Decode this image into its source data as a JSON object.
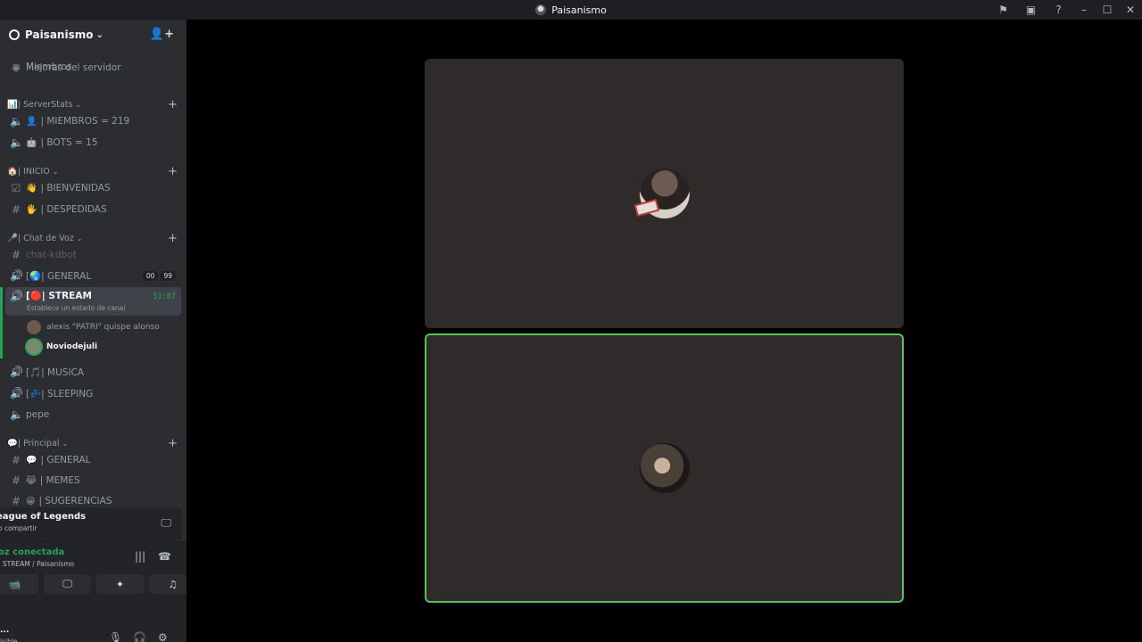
{
  "window": {
    "title": "Paisanismo"
  },
  "server": {
    "name": "Paisanismo"
  },
  "sidebar": {
    "top_items": [
      {
        "label": "Miembros",
        "icon": "members-icon"
      },
      {
        "label": "Mejoras del servidor",
        "icon": "boost-icon"
      }
    ],
    "categories": [
      {
        "label": "| ServerStats",
        "emoji": "📊",
        "channels": [
          {
            "label": "| MIEMBROS = 219",
            "emoji": "👤",
            "icon": "locked-voice-icon"
          },
          {
            "label": "| BOTS = 15",
            "emoji": "🤖",
            "icon": "locked-voice-icon"
          }
        ]
      },
      {
        "label": "| INICIO",
        "emoji": "🏠",
        "channels": [
          {
            "label": "| BIENVENIDAS",
            "emoji": "👋",
            "icon": "rules-icon"
          },
          {
            "label": "| DESPEDIDAS",
            "emoji": "🖐",
            "icon": "hash-icon"
          }
        ]
      },
      {
        "label": "| Chat de Voz",
        "emoji": "🎤",
        "channels": [
          {
            "label": "chat-kdbot",
            "icon": "hash-icon"
          },
          {
            "label": "[🌏| GENERAL",
            "icon": "voice-icon",
            "badges": [
              "00",
              "99"
            ]
          },
          {
            "label": "[🔴| STREAM",
            "icon": "voice-active-icon",
            "sub": "Establece un estado de canal",
            "timer": "51:07"
          },
          {
            "label": "[🎵| MUSICA",
            "icon": "voice-icon"
          },
          {
            "label": "[💤| SLEEPING",
            "icon": "voice-icon"
          },
          {
            "label": "pepe",
            "icon": "locked-voice-icon"
          }
        ]
      },
      {
        "label": "| Principal",
        "emoji": "💬",
        "channels": [
          {
            "label": "| GENERAL",
            "emoji": "💬",
            "icon": "hash-icon"
          },
          {
            "label": "| MEMES",
            "emoji": "😹",
            "icon": "hash-icon"
          },
          {
            "label": "| SUGERENCIAS",
            "emoji": "😀",
            "icon": "hash-icon"
          }
        ]
      }
    ],
    "voice_users": [
      {
        "name": "alexis \"PATRI\" quispe alonso",
        "speaking": false
      },
      {
        "name": "Noviodejuli",
        "speaking": true
      }
    ]
  },
  "activity": {
    "game": "eague of Legends",
    "share": "o compartir"
  },
  "rtc": {
    "status": "oz conectada",
    "where": "| STREAM / Paisanismo"
  },
  "panel": {
    "username": "...",
    "status": "isible"
  }
}
